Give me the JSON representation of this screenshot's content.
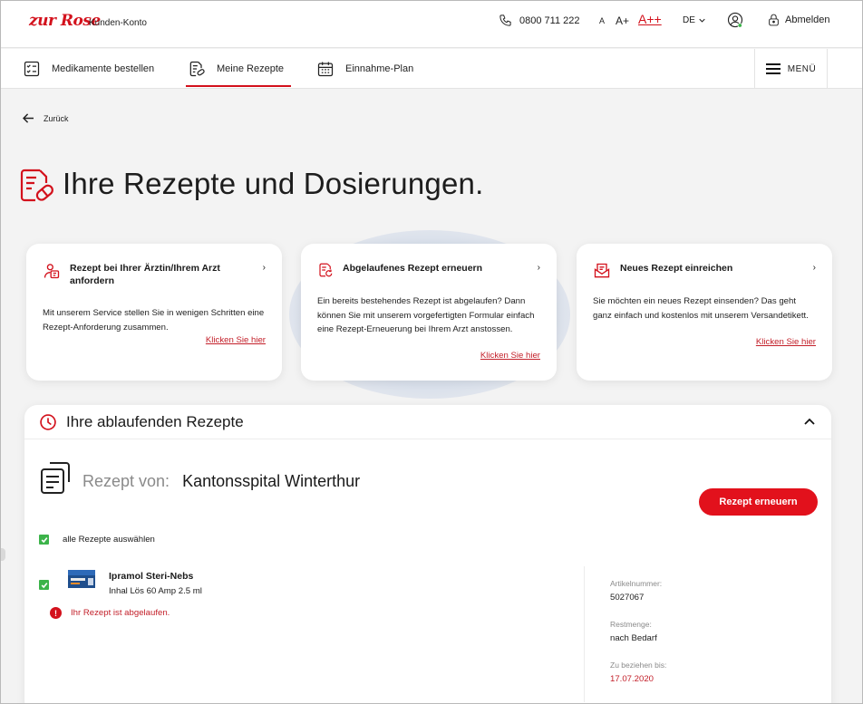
{
  "header": {
    "logo": "zur Rose",
    "logo_sub": "Kunden-Konto",
    "phone": "0800 711 222",
    "font_small": "A",
    "font_medium": "A+",
    "font_large": "A++",
    "language": "DE",
    "logout": "Abmelden"
  },
  "nav": {
    "items": [
      {
        "label": "Medikamente bestellen",
        "icon": "checklist-icon"
      },
      {
        "label": "Meine Rezepte",
        "icon": "prescription-icon",
        "active": true
      },
      {
        "label": "Einnahme-Plan",
        "icon": "calendar-icon"
      }
    ],
    "menu": "MENÜ"
  },
  "page": {
    "back": "Zurück",
    "title": "Ihre Rezepte und Dosierungen."
  },
  "cards": [
    {
      "title": "Rezept bei Ihrer Ärztin/Ihrem Arzt anfordern",
      "text": "Mit unserem Service stellen Sie in wenigen Schritten eine Rezept-Anforderung zusammen.",
      "link": "Klicken Sie hier",
      "icon": "doctor-request-icon"
    },
    {
      "title": "Abgelaufenes Rezept erneuern",
      "text": "Ein bereits bestehendes Rezept ist abgelaufen? Dann können Sie mit unserem vorgefertigten Formular einfach eine Rezept-Erneuerung bei Ihrem Arzt anstossen.",
      "link": "Klicken Sie hier",
      "icon": "renew-prescription-icon"
    },
    {
      "title": "Neues Rezept einreichen",
      "text": "Sie möchten ein neues Rezept einsenden? Das geht ganz einfach und kostenlos mit unserem Versandetikett.",
      "link": "Klicken Sie hier",
      "icon": "mail-prescription-icon"
    }
  ],
  "expiring": {
    "heading": "Ihre ablaufenden Rezepte",
    "from_label": "Rezept von:",
    "from_value": "Kantonsspital Winterthur",
    "renew_button": "Rezept erneuern",
    "select_all": "alle Rezepte auswählen",
    "product": {
      "name": "Ipramol Steri-Nebs",
      "desc": "Inhal Lös 60 Amp 2.5 ml",
      "status": "Ihr Rezept ist abgelaufen."
    },
    "meta": {
      "article_label": "Artikelnummer:",
      "article_value": "5027067",
      "rest_label": "Restmenge:",
      "rest_value": "nach Bedarf",
      "until_label": "Zu beziehen bis:",
      "until_value": "17.07.2020"
    }
  },
  "colors": {
    "brand_red": "#d3111c",
    "check_green": "#3cb34a"
  }
}
